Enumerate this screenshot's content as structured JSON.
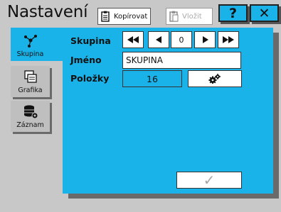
{
  "header": {
    "title": "Nastavení",
    "copy_label": "Kopírovat",
    "paste_label": "Vložit",
    "help_label": "?",
    "close_label": "✕"
  },
  "tabs": [
    {
      "label": "Skupina",
      "icon": "network-icon",
      "active": true
    },
    {
      "label": "Grafika",
      "icon": "images-icon",
      "active": false
    },
    {
      "label": "Záznam",
      "icon": "database-gear-icon",
      "active": false
    }
  ],
  "form": {
    "group_label": "Skupina",
    "group_index": "0",
    "name_label": "Jméno",
    "name_value": "SKUPINA",
    "items_label": "Položky",
    "items_value": "16"
  },
  "footer": {
    "confirm_label": "✓"
  },
  "colors": {
    "accent": "#1ab3e9",
    "background": "#c8c8c8",
    "tab_inactive": "#bfbfbf"
  }
}
